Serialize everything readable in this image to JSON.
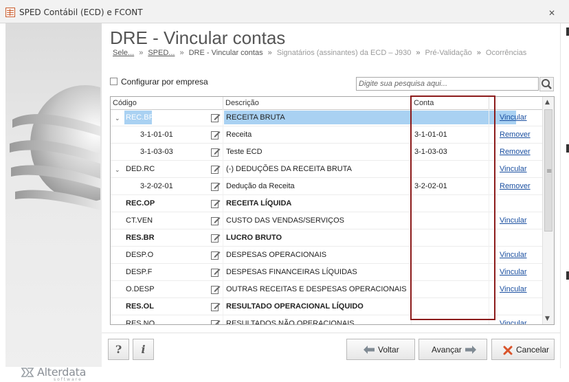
{
  "window": {
    "title": "SPED Contábil (ECD) e FCONT",
    "close_glyph": "✕"
  },
  "page": {
    "title": "DRE - Vincular contas"
  },
  "breadcrumb": [
    {
      "label": "Sele...",
      "state": "link"
    },
    {
      "label": "SPED...",
      "state": "link"
    },
    {
      "label": "DRE - Vincular contas",
      "state": "current"
    },
    {
      "label": "Signatários (assinantes) da ECD – J930",
      "state": "disabled"
    },
    {
      "label": "Pré-Validação",
      "state": "disabled"
    },
    {
      "label": "Ocorrências",
      "state": "disabled"
    }
  ],
  "breadcrumb_sep": "»",
  "config": {
    "label": "Configurar por empresa",
    "checked": false
  },
  "search": {
    "placeholder": "Digite sua pesquisa aqui...",
    "value": "",
    "icon": "search-icon"
  },
  "grid": {
    "columns": [
      "Código",
      "Descrição",
      "Conta"
    ],
    "rows": [
      {
        "code": "REC.BR",
        "desc": "RECEITA BRUTA",
        "conta": "",
        "action": "Vincular",
        "level": 0,
        "expand": "⌄",
        "bold": false,
        "selected": true
      },
      {
        "code": "3-1-01-01",
        "desc": "Receita",
        "conta": "3-1-01-01",
        "action": "Remover",
        "level": 1,
        "expand": "",
        "bold": false,
        "selected": false
      },
      {
        "code": "3-1-03-03",
        "desc": "Teste ECD",
        "conta": "3-1-03-03",
        "action": "Remover",
        "level": 1,
        "expand": "",
        "bold": false,
        "selected": false
      },
      {
        "code": "DED.RC",
        "desc": "(-) DEDUÇÕES DA RECEITA BRUTA",
        "conta": "",
        "action": "Vincular",
        "level": 0,
        "expand": "⌄",
        "bold": false,
        "selected": false
      },
      {
        "code": "3-2-02-01",
        "desc": "Dedução da Receita",
        "conta": "3-2-02-01",
        "action": "Remover",
        "level": 1,
        "expand": "",
        "bold": false,
        "selected": false
      },
      {
        "code": "REC.OP",
        "desc": "RECEITA LÍQUIDA",
        "conta": "",
        "action": "",
        "level": 0,
        "expand": "",
        "bold": true,
        "selected": false
      },
      {
        "code": "CT.VEN",
        "desc": "CUSTO DAS VENDAS/SERVIÇOS",
        "conta": "",
        "action": "Vincular",
        "level": 0,
        "expand": "",
        "bold": false,
        "selected": false
      },
      {
        "code": "RES.BR",
        "desc": "LUCRO BRUTO",
        "conta": "",
        "action": "",
        "level": 0,
        "expand": "",
        "bold": true,
        "selected": false
      },
      {
        "code": "DESP.O",
        "desc": "DESPESAS OPERACIONAIS",
        "conta": "",
        "action": "Vincular",
        "level": 0,
        "expand": "",
        "bold": false,
        "selected": false
      },
      {
        "code": "DESP.F",
        "desc": "DESPESAS FINANCEIRAS LÍQUIDAS",
        "conta": "",
        "action": "Vincular",
        "level": 0,
        "expand": "",
        "bold": false,
        "selected": false
      },
      {
        "code": "O.DESP",
        "desc": "OUTRAS RECEITAS E DESPESAS OPERACIONAIS",
        "conta": "",
        "action": "Vincular",
        "level": 0,
        "expand": "",
        "bold": false,
        "selected": false
      },
      {
        "code": "RES.OL",
        "desc": "RESULTADO OPERACIONAL LÍQUIDO",
        "conta": "",
        "action": "",
        "level": 0,
        "expand": "",
        "bold": true,
        "selected": false
      },
      {
        "code": "RES.NO",
        "desc": "RESULTADOS NÃO OPERACIONAIS",
        "conta": "",
        "action": "Vincular",
        "level": 0,
        "expand": "⌄",
        "bold": false,
        "selected": false
      }
    ]
  },
  "footer": {
    "help_label": "?",
    "info_label": "i",
    "back_label": "Voltar",
    "next_label": "Avançar",
    "cancel_label": "Cancelar"
  },
  "brand": {
    "name": "Alterdata",
    "sub": "software"
  },
  "colors": {
    "accent_selection": "#a9d1f2",
    "link": "#1a4fa0",
    "highlight_box": "#8b1a1a",
    "cancel_icon": "#d9532a",
    "arrow_icon": "#7f8a93"
  }
}
